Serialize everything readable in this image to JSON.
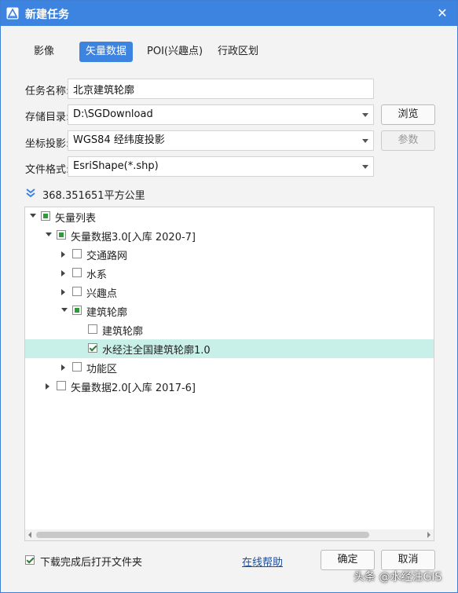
{
  "window": {
    "title": "新建任务",
    "close_glyph": "✕"
  },
  "tabs": [
    {
      "label": "影像",
      "active": false
    },
    {
      "label": "矢量数据",
      "active": true
    },
    {
      "label": "POI(兴趣点)",
      "active": false
    },
    {
      "label": "行政区划",
      "active": false
    }
  ],
  "form": {
    "task_name_label": "任务名称:",
    "task_name_value": "北京建筑轮廓",
    "storage_label": "存储目录:",
    "storage_value": "D:\\SGDownload",
    "browse_label": "浏览",
    "projection_label": "坐标投影:",
    "projection_value": "WGS84 经纬度投影",
    "params_label": "参数",
    "format_label": "文件格式:",
    "format_value": "EsriShape(*.shp)"
  },
  "area": {
    "text": "368.351651平方公里",
    "icon": "double-chevron-down-icon"
  },
  "tree": {
    "nodes": [
      {
        "label": "矢量列表",
        "level": 0,
        "expand": "down",
        "check": "partial",
        "selected": false
      },
      {
        "label": "矢量数据3.0[入库 2020-7]",
        "level": 1,
        "expand": "down",
        "check": "partial",
        "selected": false
      },
      {
        "label": "交通路网",
        "level": 2,
        "expand": "right",
        "check": "none",
        "selected": false
      },
      {
        "label": "水系",
        "level": 2,
        "expand": "right",
        "check": "none",
        "selected": false
      },
      {
        "label": "兴趣点",
        "level": 2,
        "expand": "right",
        "check": "none",
        "selected": false
      },
      {
        "label": "建筑轮廓",
        "level": 2,
        "expand": "down",
        "check": "partial",
        "selected": false
      },
      {
        "label": "建筑轮廓",
        "level": 3,
        "expand": "",
        "check": "none",
        "selected": false
      },
      {
        "label": "水经注全国建筑轮廓1.0",
        "level": 3,
        "expand": "",
        "check": "checked",
        "selected": true
      },
      {
        "label": "功能区",
        "level": 2,
        "expand": "right",
        "check": "none",
        "selected": false
      },
      {
        "label": "矢量数据2.0[入库 2017-6]",
        "level": 1,
        "expand": "right",
        "check": "none",
        "selected": false
      }
    ]
  },
  "footer": {
    "open_folder_label": "下载完成后打开文件夹",
    "help_label": "在线帮助",
    "ok_label": "确定",
    "cancel_label": "取消"
  },
  "watermark": "头条 @水经注GIS",
  "colors": {
    "accent": "#3d84e0",
    "selected_row": "#c9f0e8",
    "check_green": "#2e9c3a"
  }
}
